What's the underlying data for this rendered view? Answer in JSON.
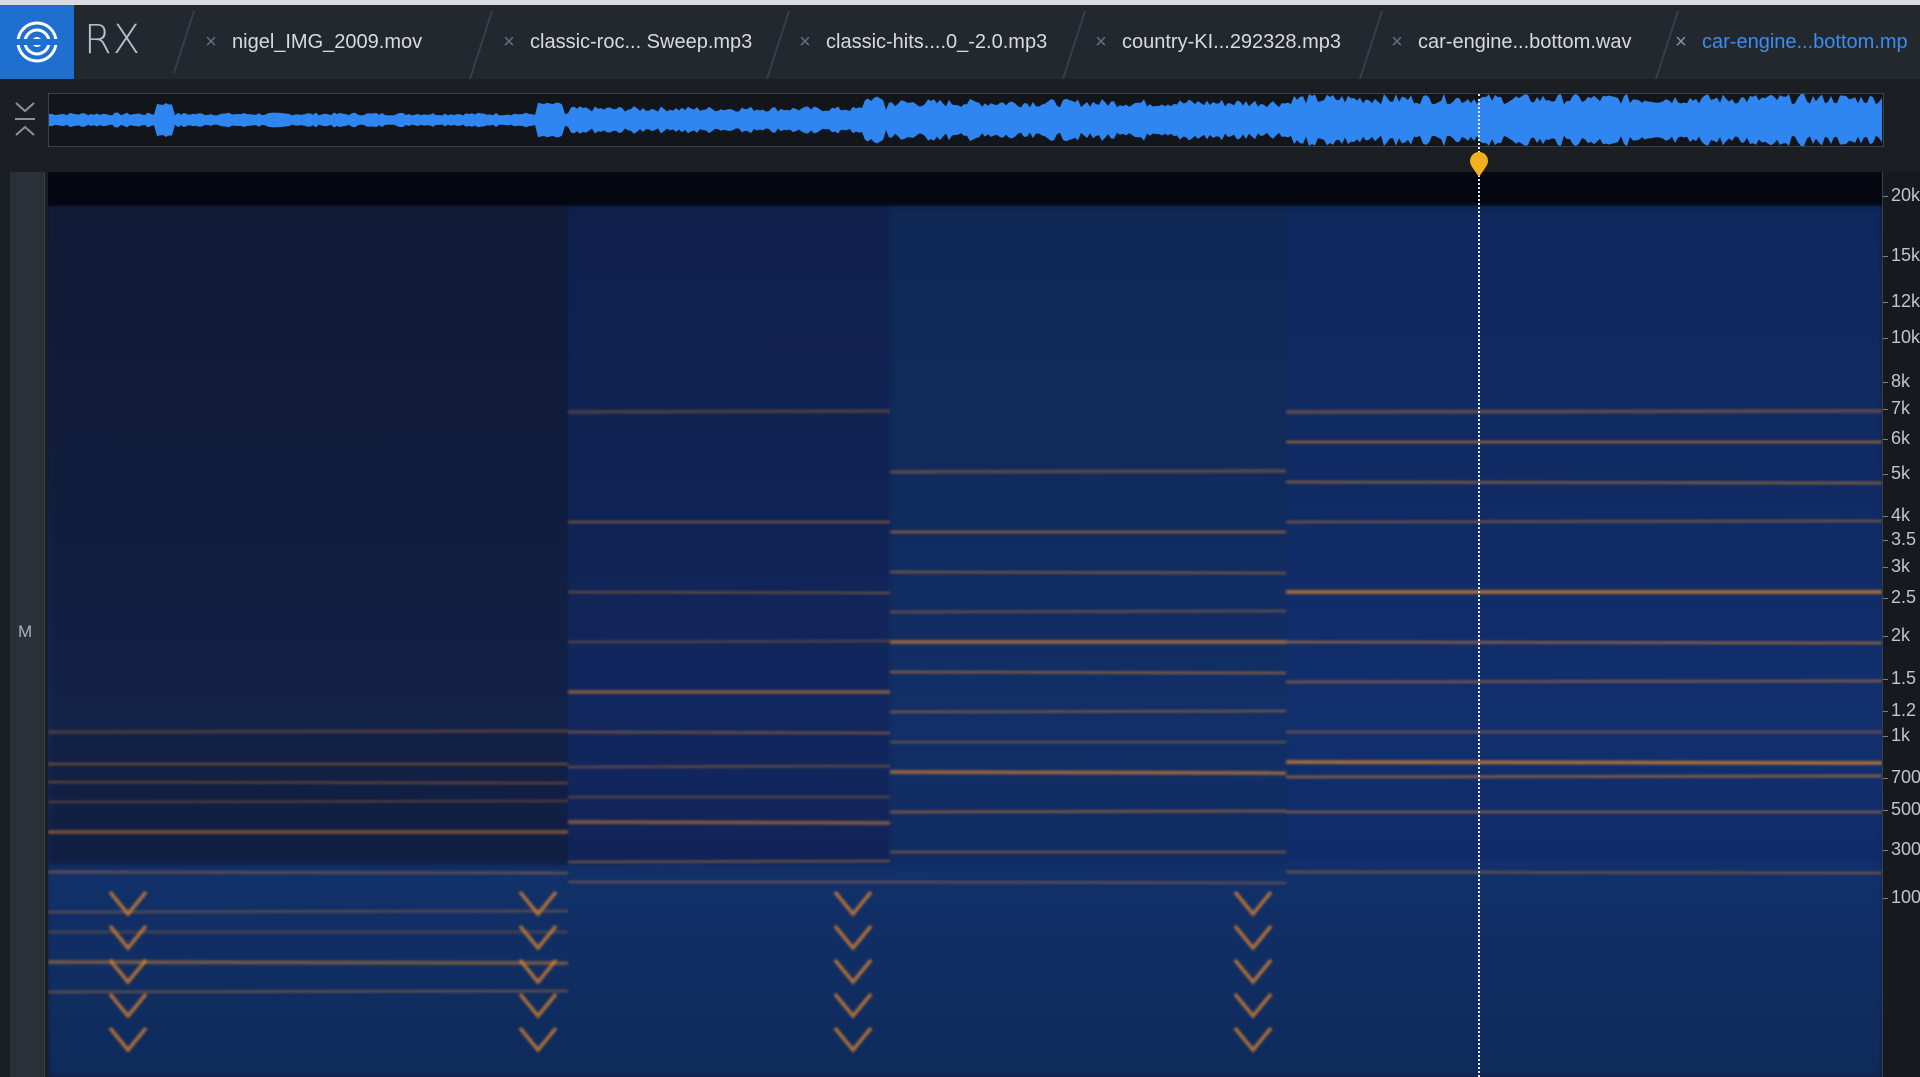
{
  "app": {
    "brand": "RX"
  },
  "tabs": [
    {
      "label": "nigel_IMG_2009.mov",
      "active": false
    },
    {
      "label": "classic-roc... Sweep.mp3",
      "active": false
    },
    {
      "label": "classic-hits....0_-2.0.mp3",
      "active": false
    },
    {
      "label": "country-KI...292328.mp3",
      "active": false
    },
    {
      "label": "car-engine...bottom.wav",
      "active": false
    },
    {
      "label": "car-engine...bottom.mp",
      "active": true
    }
  ],
  "channel": {
    "label": "M"
  },
  "frequency_axis": [
    "20k",
    "15k",
    "12k",
    "10k",
    "8k",
    "7k",
    "6k",
    "5k",
    "4k",
    "3.5",
    "3k",
    "2.5",
    "2k",
    "1.5",
    "1.2",
    "1k",
    "700",
    "500",
    "300",
    "100"
  ],
  "playhead": {
    "position_fraction": 0.78
  },
  "colors": {
    "accent": "#1f6fd1",
    "active_tab": "#3b8cf0",
    "waveform": "#2f86f0",
    "marker": "#f2b11c",
    "harmonic": "#d9822b"
  }
}
